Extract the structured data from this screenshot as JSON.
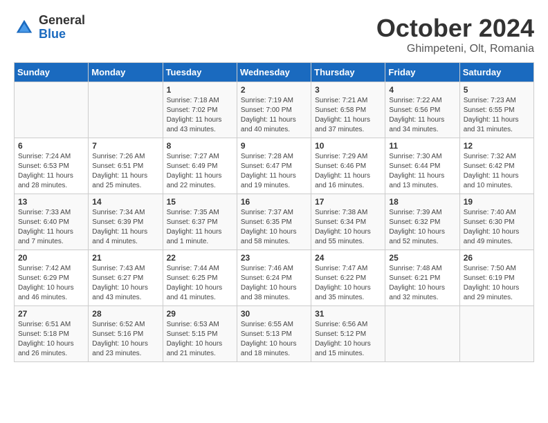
{
  "logo": {
    "general": "General",
    "blue": "Blue"
  },
  "title": "October 2024",
  "location": "Ghimpeteni, Olt, Romania",
  "days_of_week": [
    "Sunday",
    "Monday",
    "Tuesday",
    "Wednesday",
    "Thursday",
    "Friday",
    "Saturday"
  ],
  "weeks": [
    [
      {
        "day": "",
        "sunrise": "",
        "sunset": "",
        "daylight": ""
      },
      {
        "day": "",
        "sunrise": "",
        "sunset": "",
        "daylight": ""
      },
      {
        "day": "1",
        "sunrise": "Sunrise: 7:18 AM",
        "sunset": "Sunset: 7:02 PM",
        "daylight": "Daylight: 11 hours and 43 minutes."
      },
      {
        "day": "2",
        "sunrise": "Sunrise: 7:19 AM",
        "sunset": "Sunset: 7:00 PM",
        "daylight": "Daylight: 11 hours and 40 minutes."
      },
      {
        "day": "3",
        "sunrise": "Sunrise: 7:21 AM",
        "sunset": "Sunset: 6:58 PM",
        "daylight": "Daylight: 11 hours and 37 minutes."
      },
      {
        "day": "4",
        "sunrise": "Sunrise: 7:22 AM",
        "sunset": "Sunset: 6:56 PM",
        "daylight": "Daylight: 11 hours and 34 minutes."
      },
      {
        "day": "5",
        "sunrise": "Sunrise: 7:23 AM",
        "sunset": "Sunset: 6:55 PM",
        "daylight": "Daylight: 11 hours and 31 minutes."
      }
    ],
    [
      {
        "day": "6",
        "sunrise": "Sunrise: 7:24 AM",
        "sunset": "Sunset: 6:53 PM",
        "daylight": "Daylight: 11 hours and 28 minutes."
      },
      {
        "day": "7",
        "sunrise": "Sunrise: 7:26 AM",
        "sunset": "Sunset: 6:51 PM",
        "daylight": "Daylight: 11 hours and 25 minutes."
      },
      {
        "day": "8",
        "sunrise": "Sunrise: 7:27 AM",
        "sunset": "Sunset: 6:49 PM",
        "daylight": "Daylight: 11 hours and 22 minutes."
      },
      {
        "day": "9",
        "sunrise": "Sunrise: 7:28 AM",
        "sunset": "Sunset: 6:47 PM",
        "daylight": "Daylight: 11 hours and 19 minutes."
      },
      {
        "day": "10",
        "sunrise": "Sunrise: 7:29 AM",
        "sunset": "Sunset: 6:46 PM",
        "daylight": "Daylight: 11 hours and 16 minutes."
      },
      {
        "day": "11",
        "sunrise": "Sunrise: 7:30 AM",
        "sunset": "Sunset: 6:44 PM",
        "daylight": "Daylight: 11 hours and 13 minutes."
      },
      {
        "day": "12",
        "sunrise": "Sunrise: 7:32 AM",
        "sunset": "Sunset: 6:42 PM",
        "daylight": "Daylight: 11 hours and 10 minutes."
      }
    ],
    [
      {
        "day": "13",
        "sunrise": "Sunrise: 7:33 AM",
        "sunset": "Sunset: 6:40 PM",
        "daylight": "Daylight: 11 hours and 7 minutes."
      },
      {
        "day": "14",
        "sunrise": "Sunrise: 7:34 AM",
        "sunset": "Sunset: 6:39 PM",
        "daylight": "Daylight: 11 hours and 4 minutes."
      },
      {
        "day": "15",
        "sunrise": "Sunrise: 7:35 AM",
        "sunset": "Sunset: 6:37 PM",
        "daylight": "Daylight: 11 hours and 1 minute."
      },
      {
        "day": "16",
        "sunrise": "Sunrise: 7:37 AM",
        "sunset": "Sunset: 6:35 PM",
        "daylight": "Daylight: 10 hours and 58 minutes."
      },
      {
        "day": "17",
        "sunrise": "Sunrise: 7:38 AM",
        "sunset": "Sunset: 6:34 PM",
        "daylight": "Daylight: 10 hours and 55 minutes."
      },
      {
        "day": "18",
        "sunrise": "Sunrise: 7:39 AM",
        "sunset": "Sunset: 6:32 PM",
        "daylight": "Daylight: 10 hours and 52 minutes."
      },
      {
        "day": "19",
        "sunrise": "Sunrise: 7:40 AM",
        "sunset": "Sunset: 6:30 PM",
        "daylight": "Daylight: 10 hours and 49 minutes."
      }
    ],
    [
      {
        "day": "20",
        "sunrise": "Sunrise: 7:42 AM",
        "sunset": "Sunset: 6:29 PM",
        "daylight": "Daylight: 10 hours and 46 minutes."
      },
      {
        "day": "21",
        "sunrise": "Sunrise: 7:43 AM",
        "sunset": "Sunset: 6:27 PM",
        "daylight": "Daylight: 10 hours and 43 minutes."
      },
      {
        "day": "22",
        "sunrise": "Sunrise: 7:44 AM",
        "sunset": "Sunset: 6:25 PM",
        "daylight": "Daylight: 10 hours and 41 minutes."
      },
      {
        "day": "23",
        "sunrise": "Sunrise: 7:46 AM",
        "sunset": "Sunset: 6:24 PM",
        "daylight": "Daylight: 10 hours and 38 minutes."
      },
      {
        "day": "24",
        "sunrise": "Sunrise: 7:47 AM",
        "sunset": "Sunset: 6:22 PM",
        "daylight": "Daylight: 10 hours and 35 minutes."
      },
      {
        "day": "25",
        "sunrise": "Sunrise: 7:48 AM",
        "sunset": "Sunset: 6:21 PM",
        "daylight": "Daylight: 10 hours and 32 minutes."
      },
      {
        "day": "26",
        "sunrise": "Sunrise: 7:50 AM",
        "sunset": "Sunset: 6:19 PM",
        "daylight": "Daylight: 10 hours and 29 minutes."
      }
    ],
    [
      {
        "day": "27",
        "sunrise": "Sunrise: 6:51 AM",
        "sunset": "Sunset: 5:18 PM",
        "daylight": "Daylight: 10 hours and 26 minutes."
      },
      {
        "day": "28",
        "sunrise": "Sunrise: 6:52 AM",
        "sunset": "Sunset: 5:16 PM",
        "daylight": "Daylight: 10 hours and 23 minutes."
      },
      {
        "day": "29",
        "sunrise": "Sunrise: 6:53 AM",
        "sunset": "Sunset: 5:15 PM",
        "daylight": "Daylight: 10 hours and 21 minutes."
      },
      {
        "day": "30",
        "sunrise": "Sunrise: 6:55 AM",
        "sunset": "Sunset: 5:13 PM",
        "daylight": "Daylight: 10 hours and 18 minutes."
      },
      {
        "day": "31",
        "sunrise": "Sunrise: 6:56 AM",
        "sunset": "Sunset: 5:12 PM",
        "daylight": "Daylight: 10 hours and 15 minutes."
      },
      {
        "day": "",
        "sunrise": "",
        "sunset": "",
        "daylight": ""
      },
      {
        "day": "",
        "sunrise": "",
        "sunset": "",
        "daylight": ""
      }
    ]
  ]
}
